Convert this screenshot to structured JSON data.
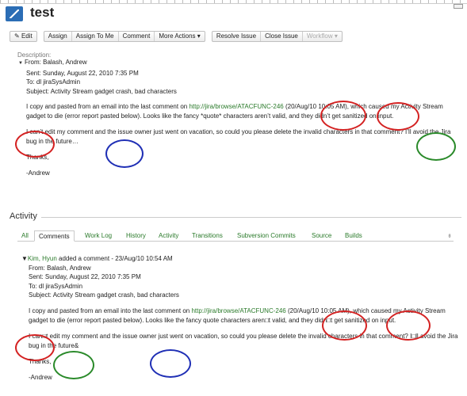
{
  "page": {
    "title": "test"
  },
  "toolbar": {
    "edit": "Edit",
    "assign": "Assign",
    "assign_to_me": "Assign To Me",
    "comment": "Comment",
    "more_actions": "More Actions",
    "resolve_issue": "Resolve Issue",
    "close_issue": "Close Issue",
    "workflow": "Workflow"
  },
  "description": {
    "label": "Description:",
    "from": "From: Balash, Andrew",
    "sent": "Sent: Sunday, August 22, 2010 7:35 PM",
    "to": "To: dl jiraSysAdmin",
    "subject": "Subject: Activity Stream gadget crash, bad characters",
    "p1_pre": "I copy and pasted from an email into the last comment on ",
    "p1_link": "http://jira/browse/ATACFUNC-246",
    "p1_post": " (20/Aug/10 10:05 AM), which caused my Activity Stream gadget to die (error report pasted below). Looks like the fancy *quote* characters aren’t valid, and they didn’t get sanitized on input.",
    "p2": "I can’t edit my comment and the issue owner just went on vacation, so could you please delete the invalid characters in that comment? I’ll avoid the Jira bug in the future…",
    "thanks": "Thanks,",
    "sign": "-Andrew"
  },
  "activity": {
    "heading": "Activity",
    "tabs": [
      "All",
      "Comments",
      "Work Log",
      "History",
      "Activity",
      "Transitions",
      "Subversion Commits",
      "Source",
      "Builds"
    ],
    "tab_control": "⇟"
  },
  "comment": {
    "author": "Kim, Hyun",
    "meta": " added a comment - 23/Aug/10 10:54 AM",
    "from": "From: Balash, Andrew",
    "sent": "Sent: Sunday, August 22, 2010 7:35 PM",
    "to": "To: dl jiraSysAdmin",
    "subject": "Subject: Activity Stream gadget crash, bad characters",
    "p1_pre": "I copy and pasted from an email into the last comment on ",
    "p1_link": "http://jira/browse/ATACFUNC-246",
    "p1_post": " (20/Aug/10 10:05 AM), which caused my Activity Stream gadget to die (error report pasted below). Looks like the fancy quote characters aren□t valid, and they didn□t get sanitized on input.",
    "p2": "I can□t edit my comment and the issue owner just went on vacation, so could you please delete the invalid characters in that comment? I□ll avoid the Jira bug in the future&",
    "thanks": "Thanks,",
    "sign": "-Andrew"
  },
  "colors": {
    "link": "#2a7a2a",
    "red_circle": "#d42222",
    "green_circle": "#2a8a2a",
    "blue_circle": "#1f2fb5",
    "logo": "#2b6db5"
  }
}
